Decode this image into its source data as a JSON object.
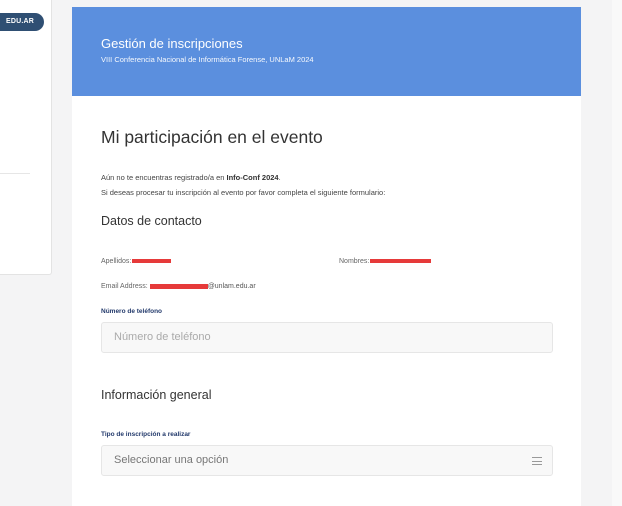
{
  "sidebar": {
    "pill_label": "EDU.AR"
  },
  "header": {
    "title": "Gestión de inscripciones",
    "subtitle": "VIII Conferencia Nacional de Informática Forense, UNLaM 2024"
  },
  "main": {
    "section_title": "Mi participación en el evento",
    "intro_line1_prefix": "Aún no te encuentras registrado/a en ",
    "intro_event": "Info-Conf 2024",
    "intro_line1_suffix": ".",
    "intro_line2": "Si deseas procesar tu inscripción al evento por favor completa el siguiente formulario:",
    "contact_title": "Datos de contacto",
    "apellidos_label": "Apellidos:",
    "nombres_label": "Nombres:",
    "email_label": "Email Address:",
    "email_domain": "@unlam.edu.ar",
    "phone_label": "Número de teléfono",
    "phone_placeholder": "Número de teléfono",
    "general_title": "Información general",
    "inscription_label": "Tipo de inscripción a realizar",
    "inscription_select_value": "Seleccionar una opción"
  },
  "colors": {
    "header_bg": "#5b8fde",
    "redaction": "#e63a3a",
    "label_accent": "#22396b"
  }
}
